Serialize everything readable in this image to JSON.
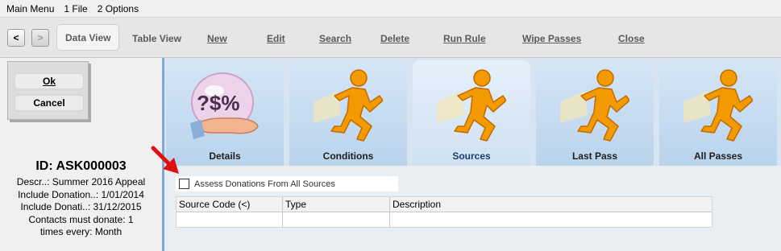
{
  "menu": {
    "items": [
      "Main Menu",
      "1 File",
      "2 Options"
    ]
  },
  "toolbar": {
    "back_label": "<",
    "forward_label": ">",
    "items": [
      "Data View",
      "Table View",
      "New",
      "Edit",
      "Search",
      "Delete",
      "Run Rule",
      "Wipe Passes",
      "Close"
    ]
  },
  "actions": {
    "ok_label": "Ok",
    "cancel_label": "Cancel"
  },
  "record": {
    "id": "ID: ASK000003",
    "lines": [
      "Descr..: Summer 2016 Appeal",
      "Include Donation..: 1/01/2014",
      "Include Donati..: 31/12/2015",
      "Contacts must donate: 1",
      "times every: Month"
    ]
  },
  "tabs": [
    {
      "label": "Details",
      "icon": "donation-hand-icon"
    },
    {
      "label": "Conditions",
      "icon": "running-man-icon"
    },
    {
      "label": "Sources",
      "icon": "running-man-icon",
      "selected": true
    },
    {
      "label": "Last Pass",
      "icon": "running-man-icon"
    },
    {
      "label": "All Passes",
      "icon": "running-man-icon"
    }
  ],
  "sources": {
    "checkbox_label": "Assess Donations From All Sources",
    "checked": false,
    "columns": [
      "Source Code (<)",
      "Type",
      "Description"
    ],
    "rows": [
      [
        "",
        "",
        ""
      ]
    ]
  },
  "colors": {
    "accent_orange": "#f39a00",
    "arrow_red": "#e01010",
    "tab_blue": "#c6dcf0",
    "divider_blue": "#7fa9d3"
  }
}
